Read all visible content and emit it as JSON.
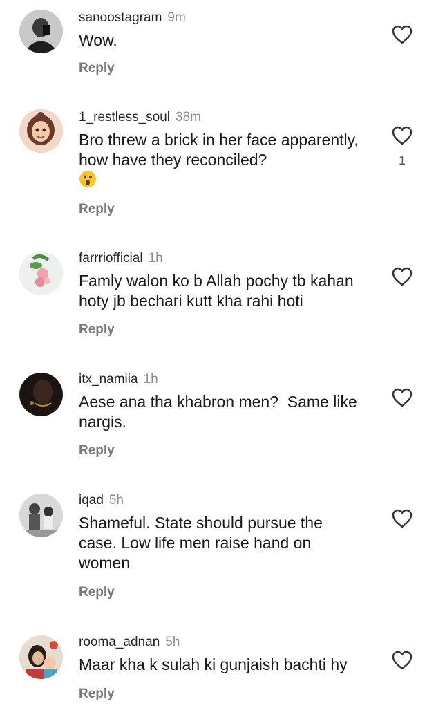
{
  "comments": [
    {
      "username": "sanoostagram",
      "time": "9m",
      "text": "Wow.",
      "reply_label": "Reply",
      "likes": ""
    },
    {
      "username": "1_restless_soul",
      "time": "38m",
      "text": "Bro threw a brick in her face apparently, how have they reconciled?",
      "emoji": "astonished-face",
      "reply_label": "Reply",
      "likes": "1"
    },
    {
      "username": "farrriofficial",
      "time": "1h",
      "text": "Famly walon ko b Allah pochy tb kahan hoty jb bechari kutt kha rahi hoti",
      "reply_label": "Reply",
      "likes": ""
    },
    {
      "username": "itx_namiia",
      "time": "1h",
      "text": "Aese ana tha khabron men?  Same like nargis.",
      "reply_label": "Reply",
      "likes": ""
    },
    {
      "username": "iqad",
      "time": "5h",
      "text": "Shameful. State should pursue the case. Low life men raise hand on women",
      "reply_label": "Reply",
      "likes": ""
    },
    {
      "username": "rooma_adnan",
      "time": "5h",
      "text": "Maar kha k sulah ki gunjaish bachti hy",
      "reply_label": "Reply",
      "likes": ""
    }
  ],
  "icons": {
    "like": "heart-outline-icon"
  },
  "colors": {
    "username": "#262626",
    "timestamp": "#8e8e8e",
    "reply": "#7a7a7a",
    "text": "#1a1a1a"
  }
}
